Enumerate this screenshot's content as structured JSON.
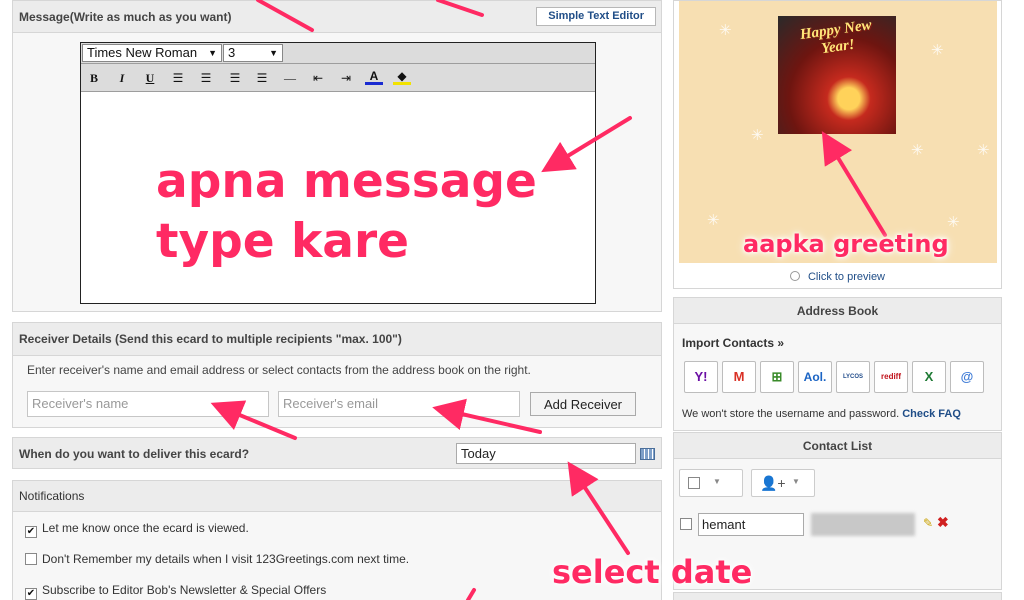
{
  "message": {
    "header": "Message(Write as much as you want)",
    "simple_editor_button": "Simple Text Editor",
    "font_family": "Times New Roman",
    "font_size": "3",
    "toolbar": [
      "bold-icon",
      "italic-icon",
      "underline-icon",
      "align-left-icon",
      "align-center-icon",
      "align-right-icon",
      "justify-icon",
      "horizontal-rule-icon",
      "outdent-icon",
      "indent-icon",
      "text-color-icon",
      "highlight-icon"
    ]
  },
  "receiver": {
    "header": "Receiver Details (Send this ecard to multiple recipients \"max. 100\")",
    "help": "Enter receiver's name and email address or select contacts from the address book on the right.",
    "name_placeholder": "Receiver's name",
    "email_placeholder": "Receiver's email",
    "add_button": "Add Receiver"
  },
  "delivery": {
    "label": "When do you want to deliver this ecard?",
    "value": "Today"
  },
  "notifications": {
    "header": "Notifications",
    "items": [
      {
        "label": "Let me know once the ecard is viewed.",
        "checked": true
      },
      {
        "label": "Don't Remember my details when I visit 123Greetings.com next time.",
        "checked": false
      },
      {
        "label": "Subscribe to Editor Bob's Newsletter & Special Offers",
        "checked": true
      }
    ]
  },
  "preview": {
    "card_text": "Happy New Year!",
    "click_to_preview": "Click to preview"
  },
  "address_book": {
    "header": "Address Book",
    "import_label": "Import Contacts »",
    "providers": [
      {
        "name": "Y!",
        "color": "#6b0fa4"
      },
      {
        "name": "M",
        "color": "#d93025"
      },
      {
        "name": "⊞",
        "color": "#3a8b2a"
      },
      {
        "name": "Aol.",
        "color": "#1b64c4"
      },
      {
        "name": "LYCOS",
        "color": "#234e8c"
      },
      {
        "name": "rediff",
        "color": "#c0121b"
      },
      {
        "name": "X",
        "color": "#1e7a34"
      },
      {
        "name": "@",
        "color": "#3e7bd6"
      }
    ],
    "note": "We won't store the username and password.",
    "note_link": "Check FAQ"
  },
  "contact_list": {
    "header": "Contact List",
    "contact_name": "hemant"
  },
  "annotations": {
    "message": [
      "apna message",
      "type kare"
    ],
    "greeting": "aapka greeting",
    "date": "select date"
  },
  "colors": {
    "accent": "#ff2a63",
    "link": "#1f4d87",
    "card_bg": "#f7dfb2"
  }
}
